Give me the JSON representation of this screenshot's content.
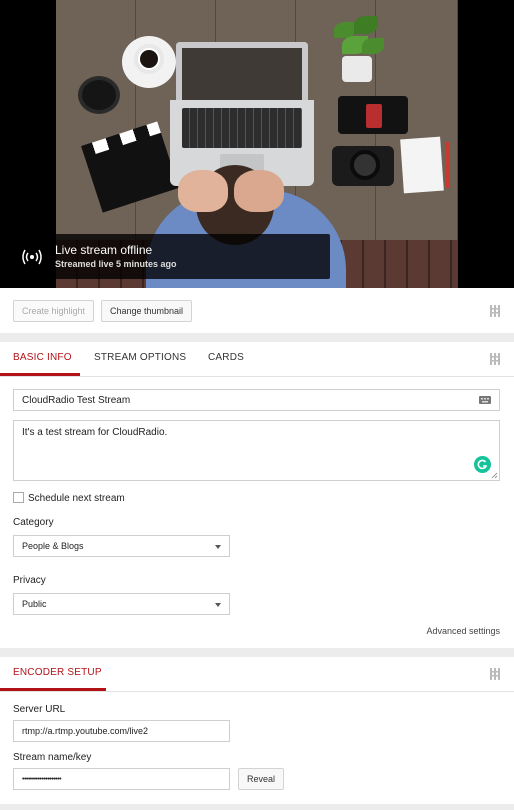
{
  "stream_status": {
    "title": "Live stream offline",
    "subtitle": "Streamed live 5 minutes ago"
  },
  "thumbnail_actions": {
    "create_highlight": "Create highlight",
    "change_thumbnail": "Change thumbnail"
  },
  "tabs": [
    {
      "label": "BASIC INFO",
      "active": true
    },
    {
      "label": "STREAM OPTIONS",
      "active": false
    },
    {
      "label": "CARDS",
      "active": false
    }
  ],
  "basic_info": {
    "title_value": "CloudRadio Test Stream",
    "description_value": "It's a test stream for CloudRadio.",
    "schedule_label": "Schedule next stream",
    "schedule_checked": false,
    "category_label": "Category",
    "category_value": "People & Blogs",
    "privacy_label": "Privacy",
    "privacy_value": "Public",
    "advanced_settings": "Advanced settings"
  },
  "encoder": {
    "tab_label": "ENCODER SETUP",
    "server_url_label": "Server URL",
    "server_url_value": "rtmp://a.rtmp.youtube.com/live2",
    "stream_key_label": "Stream name/key",
    "stream_key_value": "••••••••••••••••••••",
    "reveal_label": "Reveal"
  },
  "colors": {
    "accent": "#b31217",
    "grammarly": "#15c39a"
  },
  "icons": {
    "broadcast": "broadcast-icon",
    "drag": "drag-handle-icon",
    "grammarly": "grammarly-icon",
    "title_field_badge": "keyboard-badge-icon",
    "select_arrow": "chevron-down-icon"
  }
}
